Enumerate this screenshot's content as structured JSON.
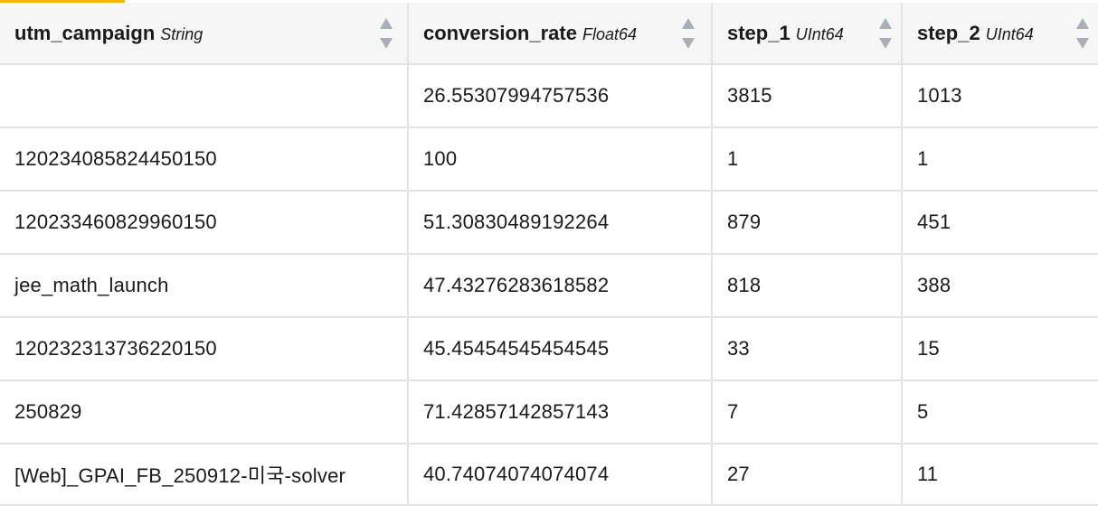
{
  "colors": {
    "accent": "#f5b800",
    "header_bg": "#f6f6f6",
    "border": "#e3e3e3",
    "sort_icon": "#a9aebb"
  },
  "columns": [
    {
      "name": "utm_campaign",
      "type": "String"
    },
    {
      "name": "conversion_rate",
      "type": "Float64"
    },
    {
      "name": "step_1",
      "type": "UInt64"
    },
    {
      "name": "step_2",
      "type": "UInt64"
    }
  ],
  "rows": [
    {
      "utm_campaign": "",
      "conversion_rate": "26.55307994757536",
      "step_1": "3815",
      "step_2": "1013"
    },
    {
      "utm_campaign": "120234085824450150",
      "conversion_rate": "100",
      "step_1": "1",
      "step_2": "1"
    },
    {
      "utm_campaign": "120233460829960150",
      "conversion_rate": "51.30830489192264",
      "step_1": "879",
      "step_2": "451"
    },
    {
      "utm_campaign": "jee_math_launch",
      "conversion_rate": "47.43276283618582",
      "step_1": "818",
      "step_2": "388"
    },
    {
      "utm_campaign": "120232313736220150",
      "conversion_rate": "45.45454545454545",
      "step_1": "33",
      "step_2": "15"
    },
    {
      "utm_campaign": "250829",
      "conversion_rate": "71.42857142857143",
      "step_1": "7",
      "step_2": "5"
    },
    {
      "utm_campaign": "[Web]_GPAI_FB_250912-미국-solver",
      "conversion_rate": "40.74074074074074",
      "step_1": "27",
      "step_2": "11"
    }
  ]
}
